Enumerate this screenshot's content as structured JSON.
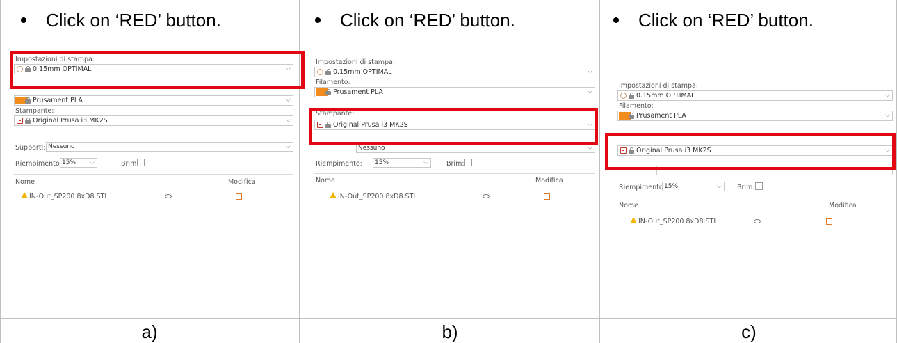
{
  "columns": [
    {
      "instruction": "Click on ‘RED’ button.",
      "caption": "a)"
    },
    {
      "instruction": "Click on ‘RED’ button.",
      "caption": "b)"
    },
    {
      "instruction": "Click on ‘RED’ button.",
      "caption": "c)"
    }
  ],
  "panel": {
    "print_settings_label": "Impostazioni di stampa:",
    "print_settings_value": "0.15mm OPTIMAL",
    "filament_label": "Filamento:",
    "filament_value": "Prusament PLA",
    "printer_label": "Stampante:",
    "printer_value": "Original Prusa i3 MK2S",
    "supports_label": "Supporti:",
    "supports_value": "Nessuno",
    "infill_label": "Riempimento:",
    "infill_value": "15%",
    "brim_label": "Brim:",
    "name_header": "Nome",
    "edit_header": "Modifica",
    "object_name": "IN-Out_SP200 8xD8.STL"
  },
  "colors": {
    "highlight": "#e30613",
    "filament_swatch": "#f28c1c"
  }
}
